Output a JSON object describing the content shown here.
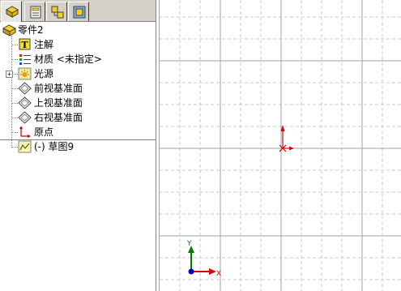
{
  "tabs": [
    {
      "name": "featuremanager-tab",
      "icon": "feature-tree-icon",
      "active": true
    },
    {
      "name": "propertymanager-tab",
      "icon": "property-sheet-icon",
      "active": false
    },
    {
      "name": "configurationmanager-tab",
      "icon": "configuration-icon",
      "active": false
    },
    {
      "name": "dimxpert-tab",
      "icon": "display-manager-icon",
      "active": false
    }
  ],
  "tree": {
    "root": {
      "label": "零件2",
      "icon": "part-icon"
    },
    "items": [
      {
        "label": "注解",
        "icon": "annotation-icon"
      },
      {
        "label": "材质 <未指定>",
        "icon": "material-icon"
      },
      {
        "label": "光源",
        "icon": "lights-icon",
        "expandable": true,
        "expander": "+"
      },
      {
        "label": "前视基准面",
        "icon": "plane-icon"
      },
      {
        "label": "上视基准面",
        "icon": "plane-icon"
      },
      {
        "label": "右视基准面",
        "icon": "plane-icon"
      },
      {
        "label": "原点",
        "icon": "origin-icon"
      },
      {
        "label": "(-) 草图9",
        "icon": "sketch-icon"
      }
    ]
  },
  "viewport": {
    "triad": {
      "x_label": "X",
      "y_label": "Y"
    },
    "colors": {
      "grid_major": "#a0a0a0",
      "grid_minor": "#c8c8c8",
      "origin": "#e00000",
      "x_axis": "#e00000",
      "y_axis": "#008000",
      "z_axis": "#0000c0"
    }
  }
}
